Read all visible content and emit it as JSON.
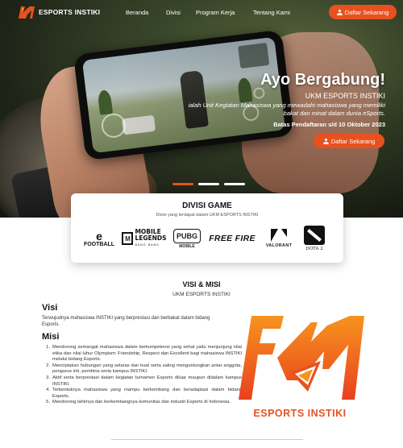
{
  "nav": {
    "brand": "ESPORTS INSTIKI",
    "links": [
      "Beranda",
      "Divisi",
      "Program Kerja",
      "Tentang Kami"
    ],
    "cta": "Daftar Sekarang"
  },
  "hero": {
    "title": "Ayo Bergabung!",
    "subtitle": "UKM ESPORTS INSTIKI",
    "description": "ialah Unit Kegiatan Mahasiswa yang mewadahi mahasiswa yang  memiliki bakat dan minat dalam dunia eSports.",
    "deadline": "Batas Pendaftaran s/d 10 Oktober 2023",
    "cta": "Daftar Sekarang"
  },
  "divisi": {
    "title": "DIVISI GAME",
    "subtitle": "Divisi yang terdapat dalam UKM ESPORTS INSTIKI",
    "games": {
      "efootball_mark": "e",
      "efootball": "FOOTBALL",
      "ml_mark": "M",
      "ml_line1": "MOBILE",
      "ml_line2": "LEGENDS",
      "ml_tag": "BANG BANG",
      "pubg": "PUBG",
      "pubg_sub": "MOBILE",
      "freefire": "FREE FIRE",
      "valorant": "VALORANT",
      "dota": "DOTA 2"
    }
  },
  "visimisi": {
    "title": "VISI & MISI",
    "subtitle": "UKM ESPORTS INSTIKI",
    "visi_heading": "Visi",
    "visi_text": "Terwujudnya mahasiswa INSTIKI yang berprestasi dan berbakat dalam bidang Esports.",
    "misi_heading": "Misi",
    "misi": [
      "Mendorong semangat mahasiswa dalam berkompetensi yang sehat yaitu menjunjung nilai etika dan nilai luhur Olympism: Friendship, Respect dan Excellent bagi mahasiswa INSTIKI melalui bidang Esports.",
      "Menciptakan hubungan yang selaras dan kuat serta saling menguntungkan antar anggota, pengurus inti, pembina serta kampus INSTIKI.",
      "Aktif serta berprestasi dalam kegiatan turnamen Esports diluar maupun didalam kampus INSTIKI.",
      "Terbentuknya mahasiswa yang mampu berkembang dan beradaptasi dalam bidang Esports.",
      "Mendorong lahirnya dan berkembangnya komunitas dan industri Esports di Indonesia."
    ],
    "logo_text": "ESPORTS INSTIKI"
  },
  "colors": {
    "accent": "#e8511f",
    "accent_light": "#f7931e"
  }
}
